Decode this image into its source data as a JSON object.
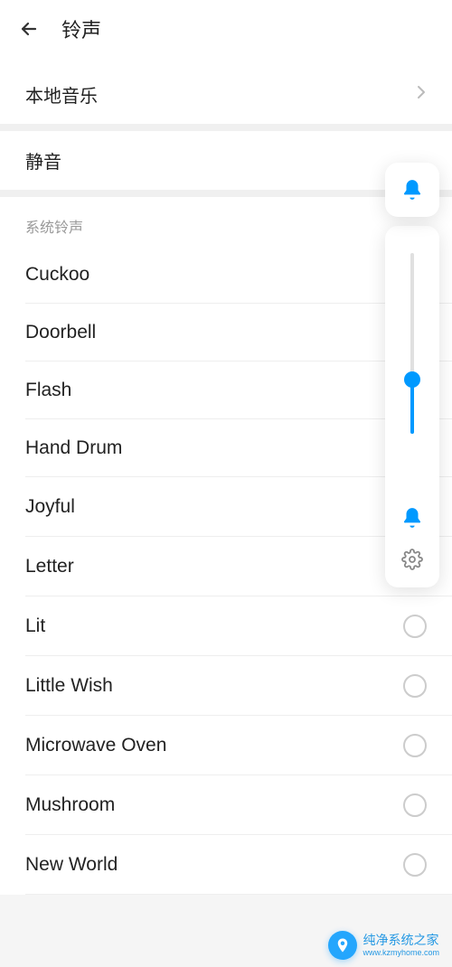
{
  "header": {
    "title": "铃声"
  },
  "localMusic": {
    "label": "本地音乐"
  },
  "silent": {
    "label": "静音"
  },
  "section": {
    "title": "系统铃声"
  },
  "ringtones": [
    {
      "label": "Cuckoo"
    },
    {
      "label": "Doorbell"
    },
    {
      "label": "Flash"
    },
    {
      "label": "Hand Drum"
    },
    {
      "label": "Joyful"
    },
    {
      "label": "Letter"
    },
    {
      "label": "Lit"
    },
    {
      "label": "Little Wish"
    },
    {
      "label": "Microwave Oven"
    },
    {
      "label": "Mushroom"
    },
    {
      "label": "New World"
    }
  ],
  "volume": {
    "percent": 30
  },
  "accentColor": "#0099ff",
  "watermark": {
    "title": "纯净系统之家",
    "url": "www.kzmyhome.com"
  }
}
